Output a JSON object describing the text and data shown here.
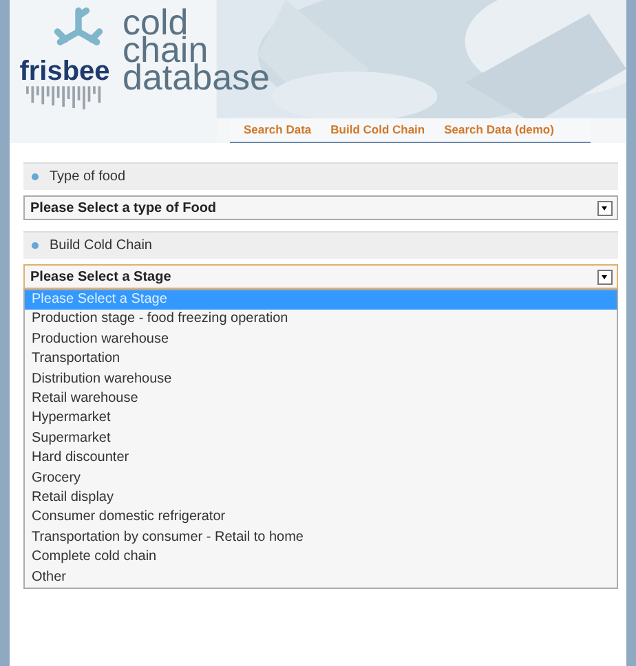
{
  "logo": {
    "brand": "frisbee",
    "title_lines": [
      "cold",
      "chain",
      "database"
    ]
  },
  "nav": [
    {
      "label": "Search Data"
    },
    {
      "label": "Build Cold Chain"
    },
    {
      "label": "Search Data (demo)"
    }
  ],
  "sections": [
    {
      "heading": "Type of food",
      "select": {
        "value": "Please Select a type of Food",
        "focused": false
      }
    },
    {
      "heading": "Build Cold Chain",
      "select": {
        "value": "Please Select a Stage",
        "focused": true,
        "expanded": true,
        "options": [
          {
            "label": "Please Select a Stage",
            "selected": true
          },
          {
            "label": "Production stage - food freezing operation",
            "selected": false
          },
          {
            "label": "Production warehouse",
            "selected": false
          },
          {
            "label": "Transportation",
            "selected": false
          },
          {
            "label": "Distribution warehouse",
            "selected": false
          },
          {
            "label": "Retail warehouse",
            "selected": false
          },
          {
            "label": "Hypermarket",
            "selected": false
          },
          {
            "label": "Supermarket",
            "selected": false
          },
          {
            "label": "Hard discounter",
            "selected": false
          },
          {
            "label": "Grocery",
            "selected": false
          },
          {
            "label": "Retail display",
            "selected": false
          },
          {
            "label": "Consumer domestic refrigerator",
            "selected": false
          },
          {
            "label": "Transportation by consumer - Retail to home",
            "selected": false
          },
          {
            "label": "Complete cold chain",
            "selected": false
          },
          {
            "label": "Other",
            "selected": false
          }
        ]
      }
    }
  ]
}
